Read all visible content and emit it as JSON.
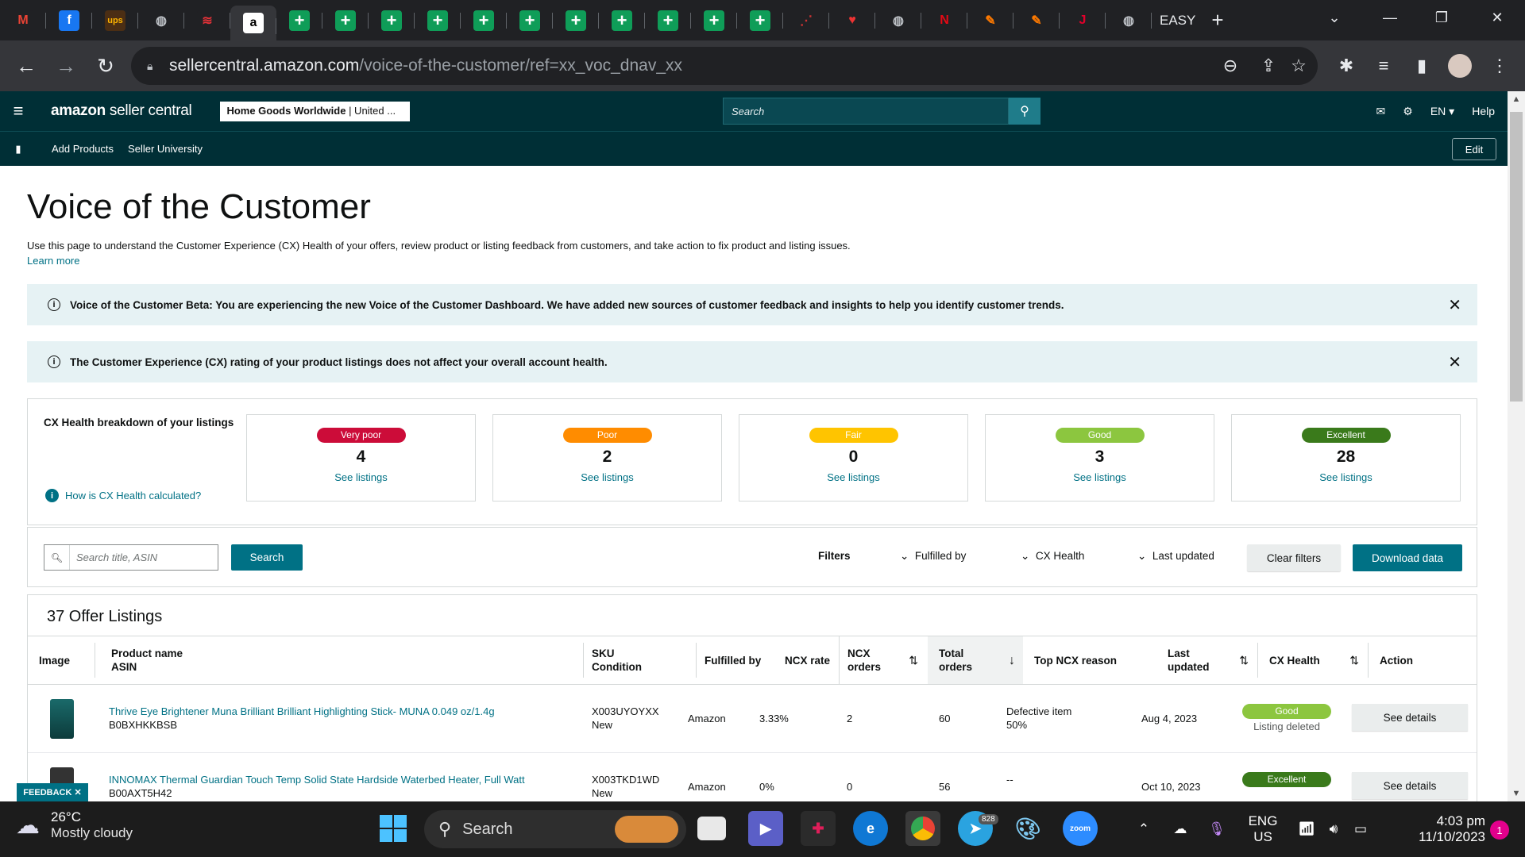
{
  "browser": {
    "tabs": [
      {
        "icon": "gmail-icon",
        "glyph": "M",
        "bg": "#202124",
        "fg": "#ea4335"
      },
      {
        "icon": "facebook-icon",
        "glyph": "f",
        "bg": "#1877f2",
        "fg": "#ffffff"
      },
      {
        "icon": "ups-icon",
        "glyph": "ups",
        "bg": "#4b2e14",
        "fg": "#ffb500"
      },
      {
        "icon": "globe-icon",
        "glyph": "◍",
        "bg": "#202124",
        "fg": "#bdc1c6"
      },
      {
        "icon": "ebay-icon",
        "glyph": "≋",
        "bg": "#202124",
        "fg": "#e53238"
      },
      {
        "icon": "amazon-icon",
        "glyph": "a",
        "bg": "#ffffff",
        "fg": "#000000"
      }
    ],
    "sheet_tab_count": 11,
    "tabs_after": [
      {
        "icon": "chart-icon",
        "glyph": "⋰",
        "fg": "#c33"
      },
      {
        "icon": "heart-rate-icon",
        "glyph": "♥",
        "fg": "#e33"
      },
      {
        "icon": "globe-icon",
        "glyph": "◍",
        "fg": "#bdc1c6"
      },
      {
        "icon": "netflix-icon",
        "glyph": "N",
        "fg": "#e50914"
      },
      {
        "icon": "pen-icon",
        "glyph": "✎",
        "fg": "#ff7a00"
      },
      {
        "icon": "pen-icon",
        "glyph": "✎",
        "fg": "#ff7a00"
      },
      {
        "icon": "jt-icon",
        "glyph": "J",
        "fg": "#e3002b"
      },
      {
        "icon": "globe-icon",
        "glyph": "◍",
        "fg": "#bdc1c6"
      }
    ],
    "easy_tab_label": "EASY",
    "new_tab": "+",
    "url_host": "sellercentral.amazon.com",
    "url_path": "/voice-of-the-customer/ref=xx_voc_dnav_xx"
  },
  "header": {
    "logo_bold": "amazon",
    "logo_rest": " seller central",
    "store_bold": "Home Goods Worldwide",
    "store_rest": " | United ...",
    "search_placeholder": "Search",
    "lang": "EN ▾",
    "help": "Help",
    "subnav": [
      "Add Products",
      "Seller University"
    ],
    "edit": "Edit"
  },
  "page": {
    "title": "Voice of the Customer",
    "description": "Use this page to understand the Customer Experience (CX) Health of your offers, review product or listing feedback from customers, and take action to fix product and listing issues.",
    "learn_more": "Learn more",
    "banner1": "Voice of the Customer Beta: You are experiencing the new Voice of the Customer Dashboard. We have added new sources of customer feedback and insights to help you identify customer trends.",
    "banner2": "The Customer Experience (CX) rating of your product listings does not affect your overall account health."
  },
  "cx": {
    "title": "CX Health breakdown of your listings",
    "how_link": "How is CX Health calculated?",
    "cards": [
      {
        "label": "Very poor",
        "count": "4",
        "link": "See listings",
        "color": "#cc0c39"
      },
      {
        "label": "Poor",
        "count": "2",
        "link": "See listings",
        "color": "#ff8c00"
      },
      {
        "label": "Fair",
        "count": "0",
        "link": "See listings",
        "color": "#ffc400"
      },
      {
        "label": "Good",
        "count": "3",
        "link": "See listings",
        "color": "#8cc63f"
      },
      {
        "label": "Excellent",
        "count": "28",
        "link": "See listings",
        "color": "#3a7a1b"
      }
    ]
  },
  "filters": {
    "search_placeholder": "Search title, ASIN",
    "search_btn": "Search",
    "label": "Filters",
    "fulfilled_by": "Fulfilled by",
    "cx_health": "CX Health",
    "last_updated": "Last updated",
    "clear": "Clear filters",
    "download": "Download data"
  },
  "table": {
    "title": "37 Offer Listings",
    "headers": {
      "image": "Image",
      "product_name": "Product name",
      "asin": "ASIN",
      "sku": "SKU",
      "condition": "Condition",
      "fulfilled_by": "Fulfilled by",
      "ncx_rate": "NCX rate",
      "ncx_orders_1": "NCX",
      "ncx_orders_2": "orders",
      "total_orders_1": "Total",
      "total_orders_2": "orders",
      "top_reason": "Top NCX reason",
      "last_updated_1": "Last",
      "last_updated_2": "updated",
      "cx_health": "CX Health",
      "action": "Action"
    },
    "rows": [
      {
        "product": "Thrive Eye Brightener Muna Brilliant Brilliant Highlighting Stick- MUNA 0.049 oz/1.4g",
        "asin": "B0BXHKKBSB",
        "sku": "X003UYOYXX",
        "condition": "New",
        "fulfilled": "Amazon",
        "ncx_rate": "3.33%",
        "ncx_orders": "2",
        "total_orders": "60",
        "reason": "Defective item",
        "reason_pct": "50%",
        "updated": "Aug 4, 2023",
        "health": "Good",
        "health_color": "#8cc63f",
        "health_note": "Listing deleted",
        "action": "See details"
      },
      {
        "product": "INNOMAX Thermal Guardian Touch Temp Solid State Hardside Waterbed Heater, Full Watt",
        "asin": "B00AXT5H42",
        "sku": "X003TKD1WD",
        "condition": "New",
        "fulfilled": "Amazon",
        "ncx_rate": "0%",
        "ncx_orders": "0",
        "total_orders": "56",
        "reason": "--",
        "reason_pct": "",
        "updated": "Oct 10, 2023",
        "health": "Excellent",
        "health_color": "#3a7a1b",
        "health_note": "",
        "action": "See details"
      }
    ]
  },
  "feedback": "FEEDBACK ✕",
  "taskbar": {
    "temp": "26°C",
    "weather": "Mostly cloudy",
    "search": "Search",
    "telegram_badge": "828",
    "lang1": "ENG",
    "lang2": "US",
    "time": "4:03 pm",
    "date": "11/10/2023",
    "notif": "1"
  }
}
